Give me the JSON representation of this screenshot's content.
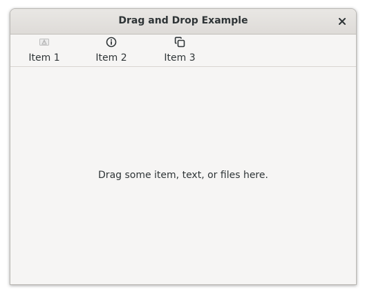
{
  "window": {
    "title": "Drag and Drop Example"
  },
  "toolbar": {
    "items": [
      {
        "label": "Item 1",
        "icon": "image-missing-icon"
      },
      {
        "label": "Item 2",
        "icon": "info-icon"
      },
      {
        "label": "Item 3",
        "icon": "copy-icon"
      }
    ]
  },
  "drop_area": {
    "hint": "Drag some item, text, or files here."
  }
}
